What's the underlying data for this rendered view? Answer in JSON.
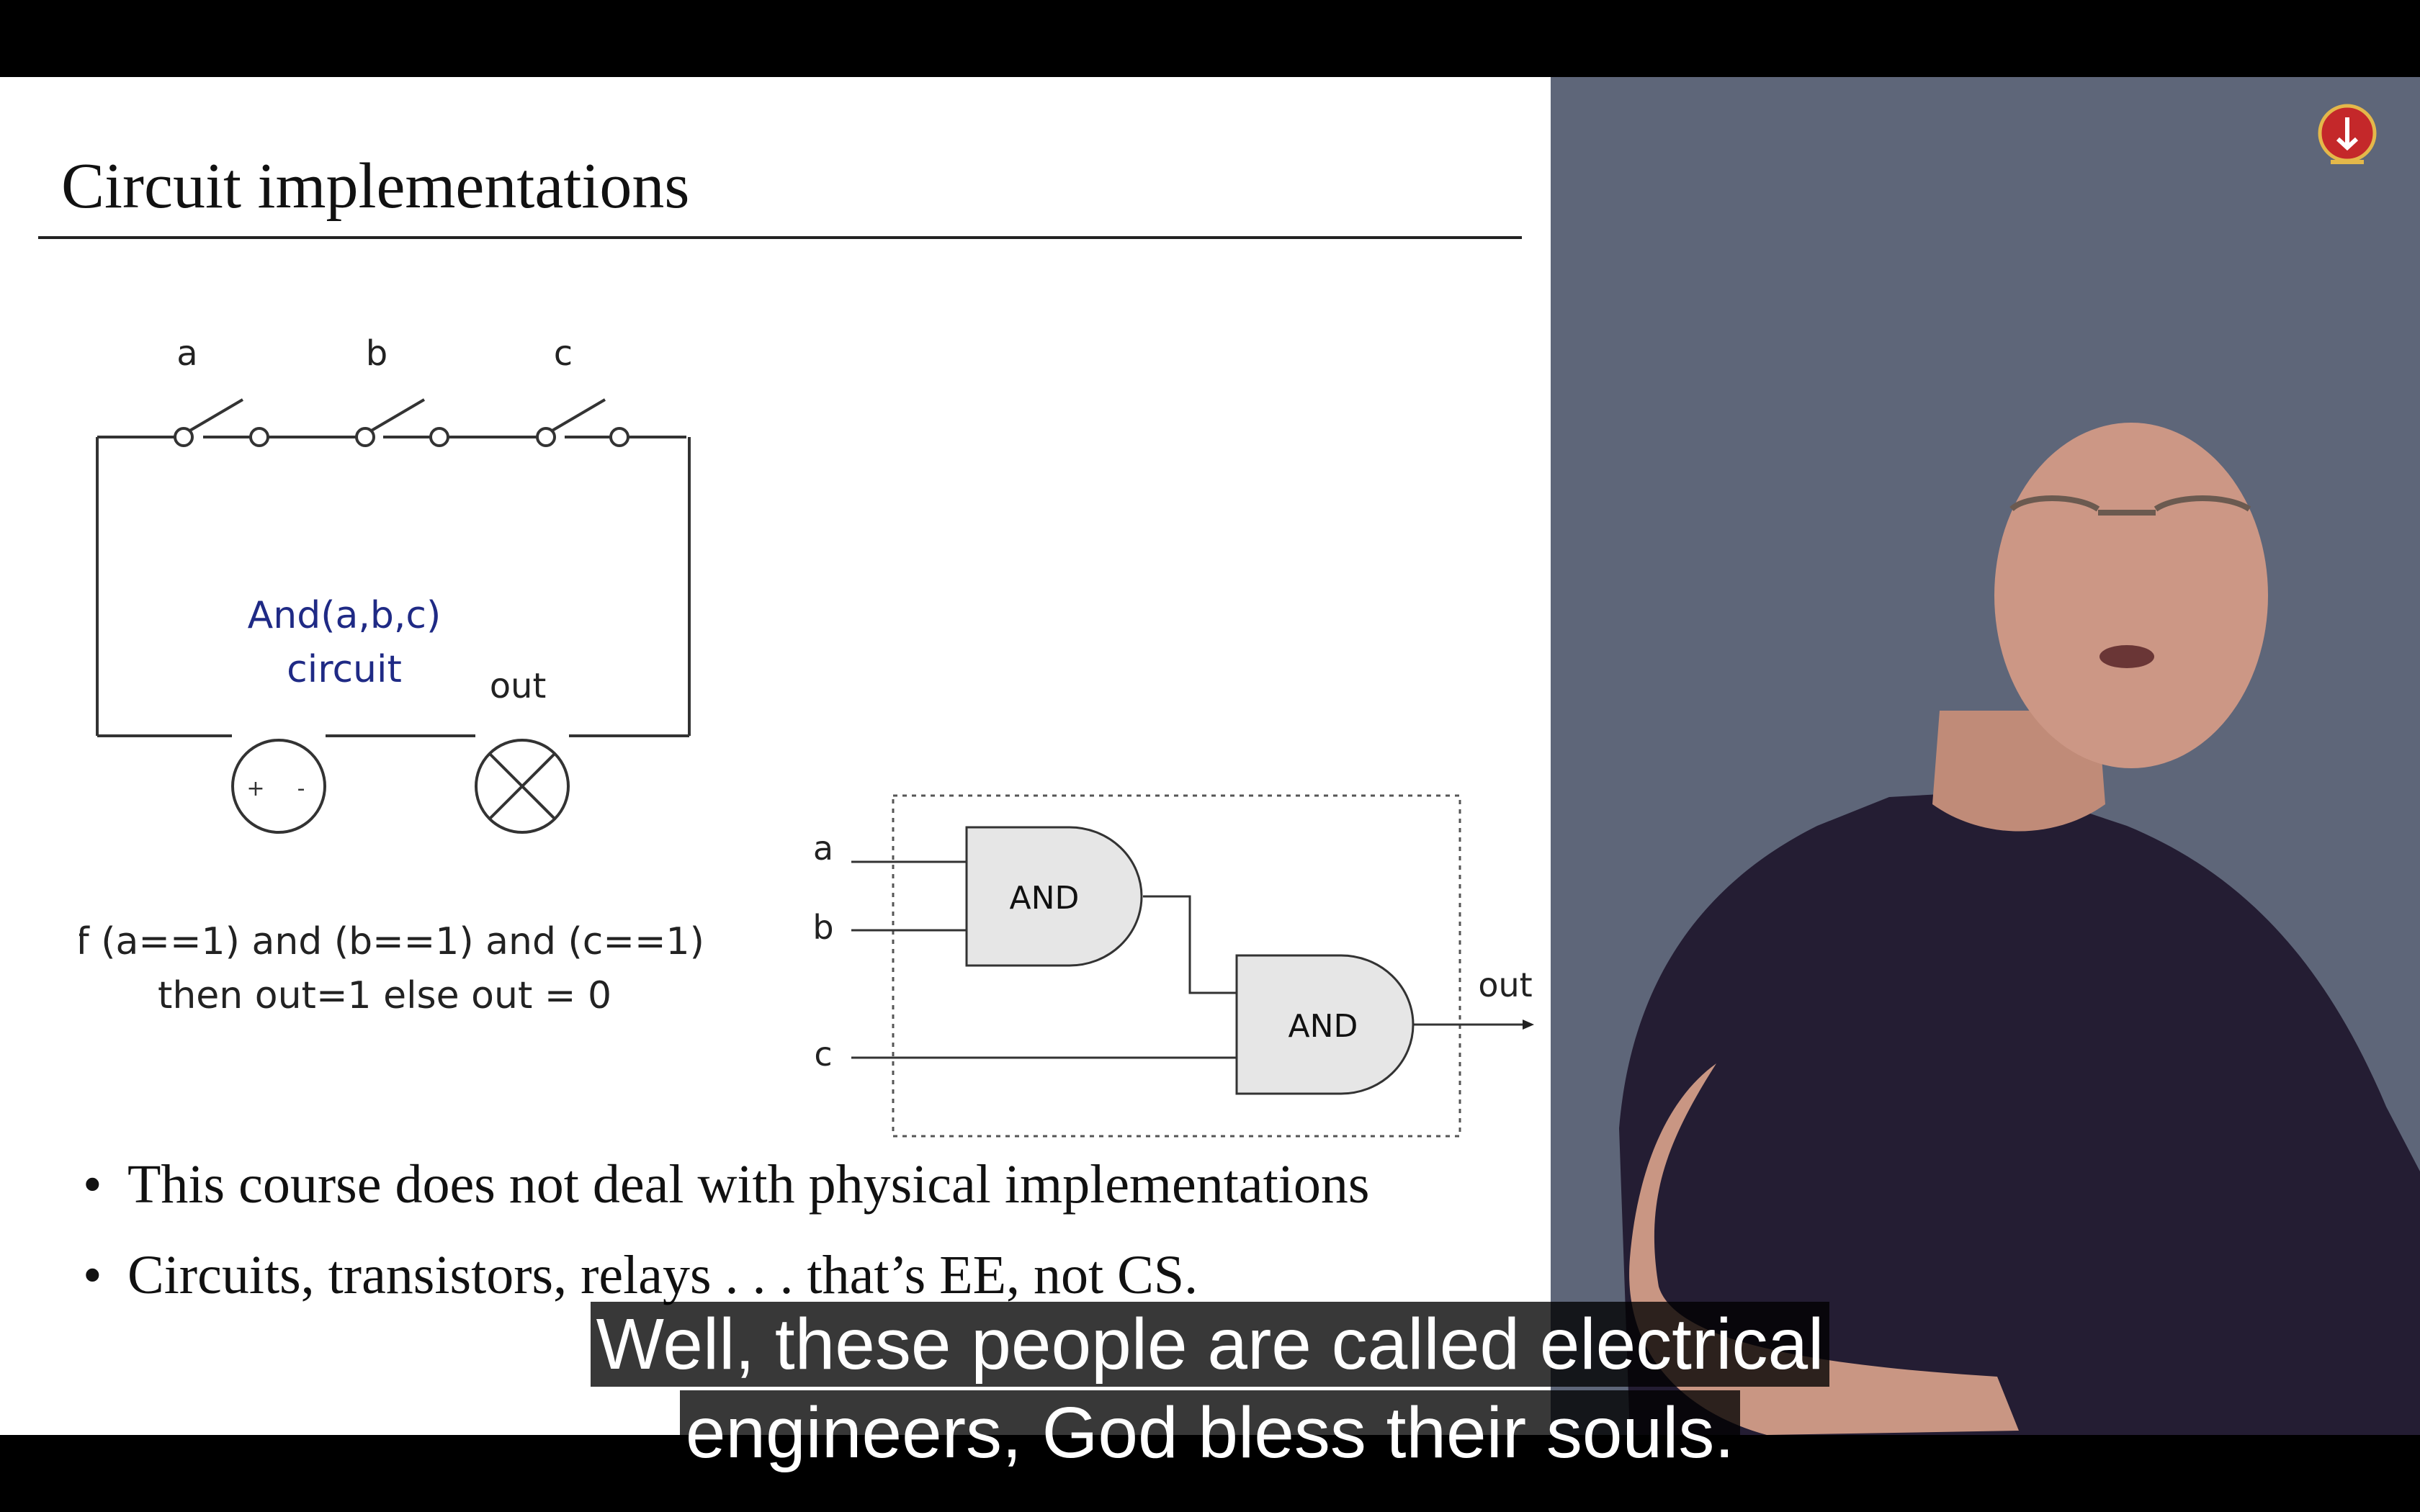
{
  "slide": {
    "title": "Circuit implementations",
    "circuit": {
      "switch_labels": [
        "a",
        "b",
        "c"
      ],
      "name_line1": "And(a,b,c)",
      "name_line2": "circuit",
      "out_label": "out",
      "battery_plus": "+",
      "battery_minus": "-",
      "rule_line1": "If (a==1) and (b==1) and (c==1)",
      "rule_line2": "then out=1 else out = 0"
    },
    "gates": {
      "inputs": [
        "a",
        "b",
        "c"
      ],
      "gate1_label": "AND",
      "gate2_label": "AND",
      "out_label": "out"
    },
    "bullets": [
      "This course does not deal with physical implementations",
      "Circuits, transistors, relays . . . that’s EE, not CS."
    ]
  },
  "colors": {
    "circuit_text": "#1f2a85",
    "gate_fill": "#e6e6e6",
    "video_bg": "#5e6679",
    "logo_red": "#c4282a"
  },
  "caption": {
    "line1": "Well, these people are called electrical",
    "line2": "engineers, God bless their souls."
  }
}
